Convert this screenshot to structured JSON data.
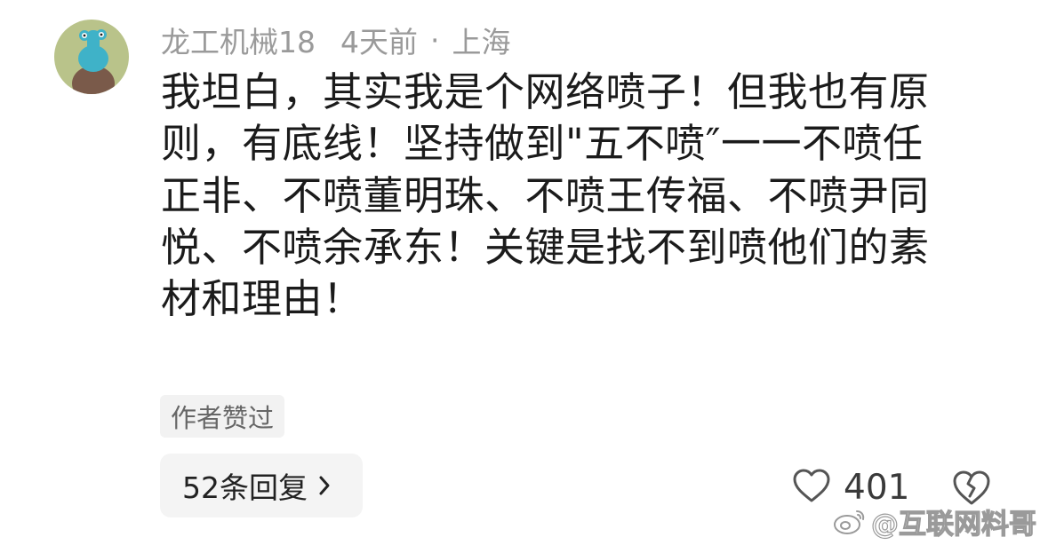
{
  "comment": {
    "author": "龙工机械18",
    "time": "4天前",
    "separator": "·",
    "location": "上海",
    "text_lines": [
      "我坦白，其实我是个网络喷子！但我也有原",
      "则，有底线！坚持做到\"五不喷″一一不喷任",
      "正非、不喷董明珠、不喷王传福、不喷尹同",
      "悦、不喷余承东！关键是找不到喷他们的素",
      "材和理由！"
    ],
    "author_liked_badge": "作者赞过",
    "replies_label": "52条回复",
    "like_count": "401"
  },
  "icons": {
    "avatar": "avatar-cartoon",
    "replies_chevron": "chevron-right-icon",
    "like": "heart-outline-icon",
    "dislike": "broken-heart-icon",
    "watermark_logo": "weibo-logo-icon"
  },
  "watermark": {
    "text": "@互联网料哥"
  },
  "colors": {
    "text_primary": "#1b1b1b",
    "text_meta": "#9a9a9a",
    "badge_bg": "#f2f2f2",
    "reply_bg": "#f4f4f4",
    "avatar_bg": "#b9c38a"
  }
}
